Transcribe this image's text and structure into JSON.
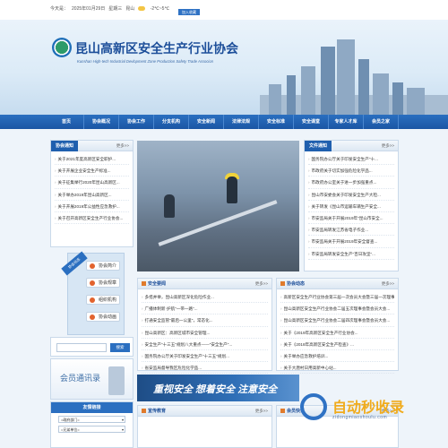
{
  "topbar": {
    "today_label": "今天是：",
    "date": "2025年01月29日",
    "weekday": "星期三",
    "city": "昆山",
    "temp": "-2℃~5℃",
    "button": "加入收藏"
  },
  "header": {
    "title": "昆山高新区安全生产行业协会",
    "subtitle": "Kunshan High-tech Industrial Devlopment Zone Production Safety Trade Associon"
  },
  "nav": {
    "items": [
      "首页",
      "协会概况",
      "协会工作",
      "分支机构",
      "安全新闻",
      "法律法规",
      "安全标准",
      "安全课堂",
      "专家人才库",
      "会员之家"
    ]
  },
  "notice_box": {
    "title": "协会通知",
    "more": "更多>>",
    "items": [
      "关于2021年度高新区安全职护...",
      "关于开展企业安全生产标准...",
      "关于征集举行2020年昆山高新区...",
      "关于举办2019年昆山高新区...",
      "关于开展2019年公益性应急救护...",
      "关于召开高新区安全生产行业协会..."
    ]
  },
  "side_buttons": {
    "label": "协会动态",
    "items": [
      "协会简介",
      "协会规章",
      "组织机构",
      "协会动画"
    ]
  },
  "search": {
    "placeholder": "",
    "button": "搜索"
  },
  "contacts": {
    "title": "会员通讯录"
  },
  "links": {
    "title": "友情链接",
    "selects": [
      "=政府部门=",
      "=兄弟单位="
    ]
  },
  "files_box": {
    "title": "文件通知",
    "more": "更多>>",
    "items": [
      "国务院办公厅关于印发安全生产\"十...",
      "市政府关于切实加强危险化学品...",
      "市政府办公室关于进一步加强重点...",
      "昆山市安委会关于印发安全生产大检...",
      "关于转发《昆山市运输车辆生产安全...",
      "市安监局关于开展2019年\"昆山市安全...",
      "市安监局转发江苏省电子作业...",
      "市安监局关于开展2019年安全督查...",
      "市安监局转发安全生产\"百日攻坚\"..."
    ]
  },
  "news_box": {
    "title": "安全要闻",
    "more": "更多>>",
    "items": [
      "多措并举，昆山高新区深化危险作业...",
      "广播体制新·护航“一带一路”...",
      "打通安全监管\"最后一公里\"，常态化...",
      "昆山高新区：高新区城市安全管理...",
      "安全生产\"十三五\"规划八大重点——\"安全生产\"...",
      "国务院办公厅关于印发安全生产\"十三五\"规划...",
      "省安监局督导我区危险化学品..."
    ]
  },
  "dynamics_box": {
    "title": "协会动态",
    "more": "更多>>",
    "items": [
      "高新区安全生产行业协会第三届一次会员大会暨三届一次理事...",
      "昆山高新区安全生产行业协会二届五次理事会暨会员大会...",
      "昆山高新区安全生产行业协会二届四次理事会暨会员大会...",
      "关于《2019年高新区安全生产行业协会...",
      "关于《2018年高新区安全生产检查》...",
      "关于举办应急救护培训...",
      "关于大唐村日用高新中心站..."
    ]
  },
  "slogan": {
    "text": "重视安全  想着安全  注意安全"
  },
  "edu_box": {
    "title": "宣传教育",
    "more": "更多>>"
  },
  "member_box": {
    "title": "会员快讯",
    "more": "更多>>"
  },
  "watermark": {
    "text": "自动秒收录",
    "url": "zidongmiaoshoulu.com"
  },
  "colors": {
    "brand_blue": "#1f5fae",
    "accent_orange": "#e07b2c",
    "title_blue": "#1d4f9a"
  }
}
